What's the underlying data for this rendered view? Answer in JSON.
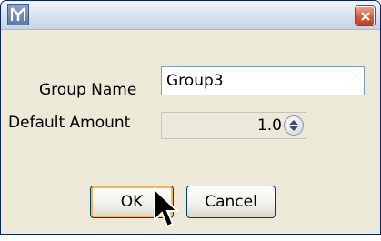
{
  "dialog": {
    "fields": {
      "group_name_label": "Group Name",
      "group_name_value": "Group3",
      "default_amount_label": "Default Amount",
      "default_amount_value": "1.0"
    },
    "buttons": {
      "ok": "OK",
      "cancel": "Cancel"
    }
  },
  "icons": {
    "app": "app-logo-icon",
    "close": "close-icon",
    "spinner": "spinner-arrows-icon",
    "cursor": "mouse-cursor-icon"
  },
  "colors": {
    "close_button": "#d85d3d",
    "default_button_focus": "#f7b64e",
    "window_background": "#ece9d8"
  }
}
